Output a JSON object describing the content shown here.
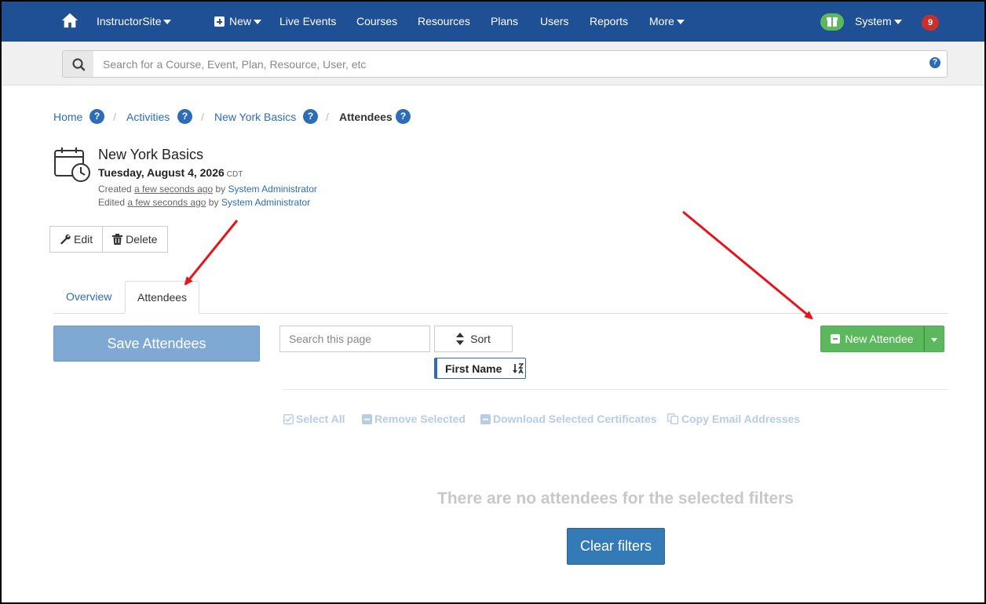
{
  "nav": {
    "brand": "InstructorSite",
    "new": "New",
    "live_events": "Live Events",
    "courses": "Courses",
    "resources": "Resources",
    "plans": "Plans",
    "users": "Users",
    "reports": "Reports",
    "more": "More",
    "system": "System",
    "notifications": "9"
  },
  "search": {
    "placeholder": "Search for a Course, Event, Plan, Resource, User, etc",
    "help": "?"
  },
  "breadcrumb": {
    "home": "Home",
    "activities": "Activities",
    "event": "New York Basics",
    "current": "Attendees",
    "sep": "/",
    "help": "?"
  },
  "event": {
    "title": "New York Basics",
    "date": "Tuesday, August 4, 2026",
    "tz": "CDT",
    "created_prefix": "Created",
    "created_when": "a few seconds ago",
    "created_by_word": "by",
    "created_by": "System Administrator",
    "edited_prefix": "Edited",
    "edited_when": "a few seconds ago",
    "edited_by_word": "by",
    "edited_by": "System Administrator"
  },
  "actions": {
    "edit": "Edit",
    "delete": "Delete"
  },
  "tabs": {
    "overview": "Overview",
    "attendees": "Attendees"
  },
  "attendees": {
    "save": "Save Attendees",
    "search_placeholder": "Search this page",
    "sort": "Sort",
    "sort_chip": "First Name",
    "new_attendee": "New Attendee",
    "select_all": "Select All",
    "remove_selected": "Remove Selected",
    "download_certificates": "Download Selected Certificates",
    "copy_emails": "Copy Email Addresses",
    "empty": "There are no attendees for the selected filters",
    "clear_filters": "Clear filters"
  },
  "colors": {
    "nav_bg": "#1f4f95",
    "link": "#2c6db5",
    "success": "#5cb85c",
    "annotation_arrow": "#e8141b"
  }
}
